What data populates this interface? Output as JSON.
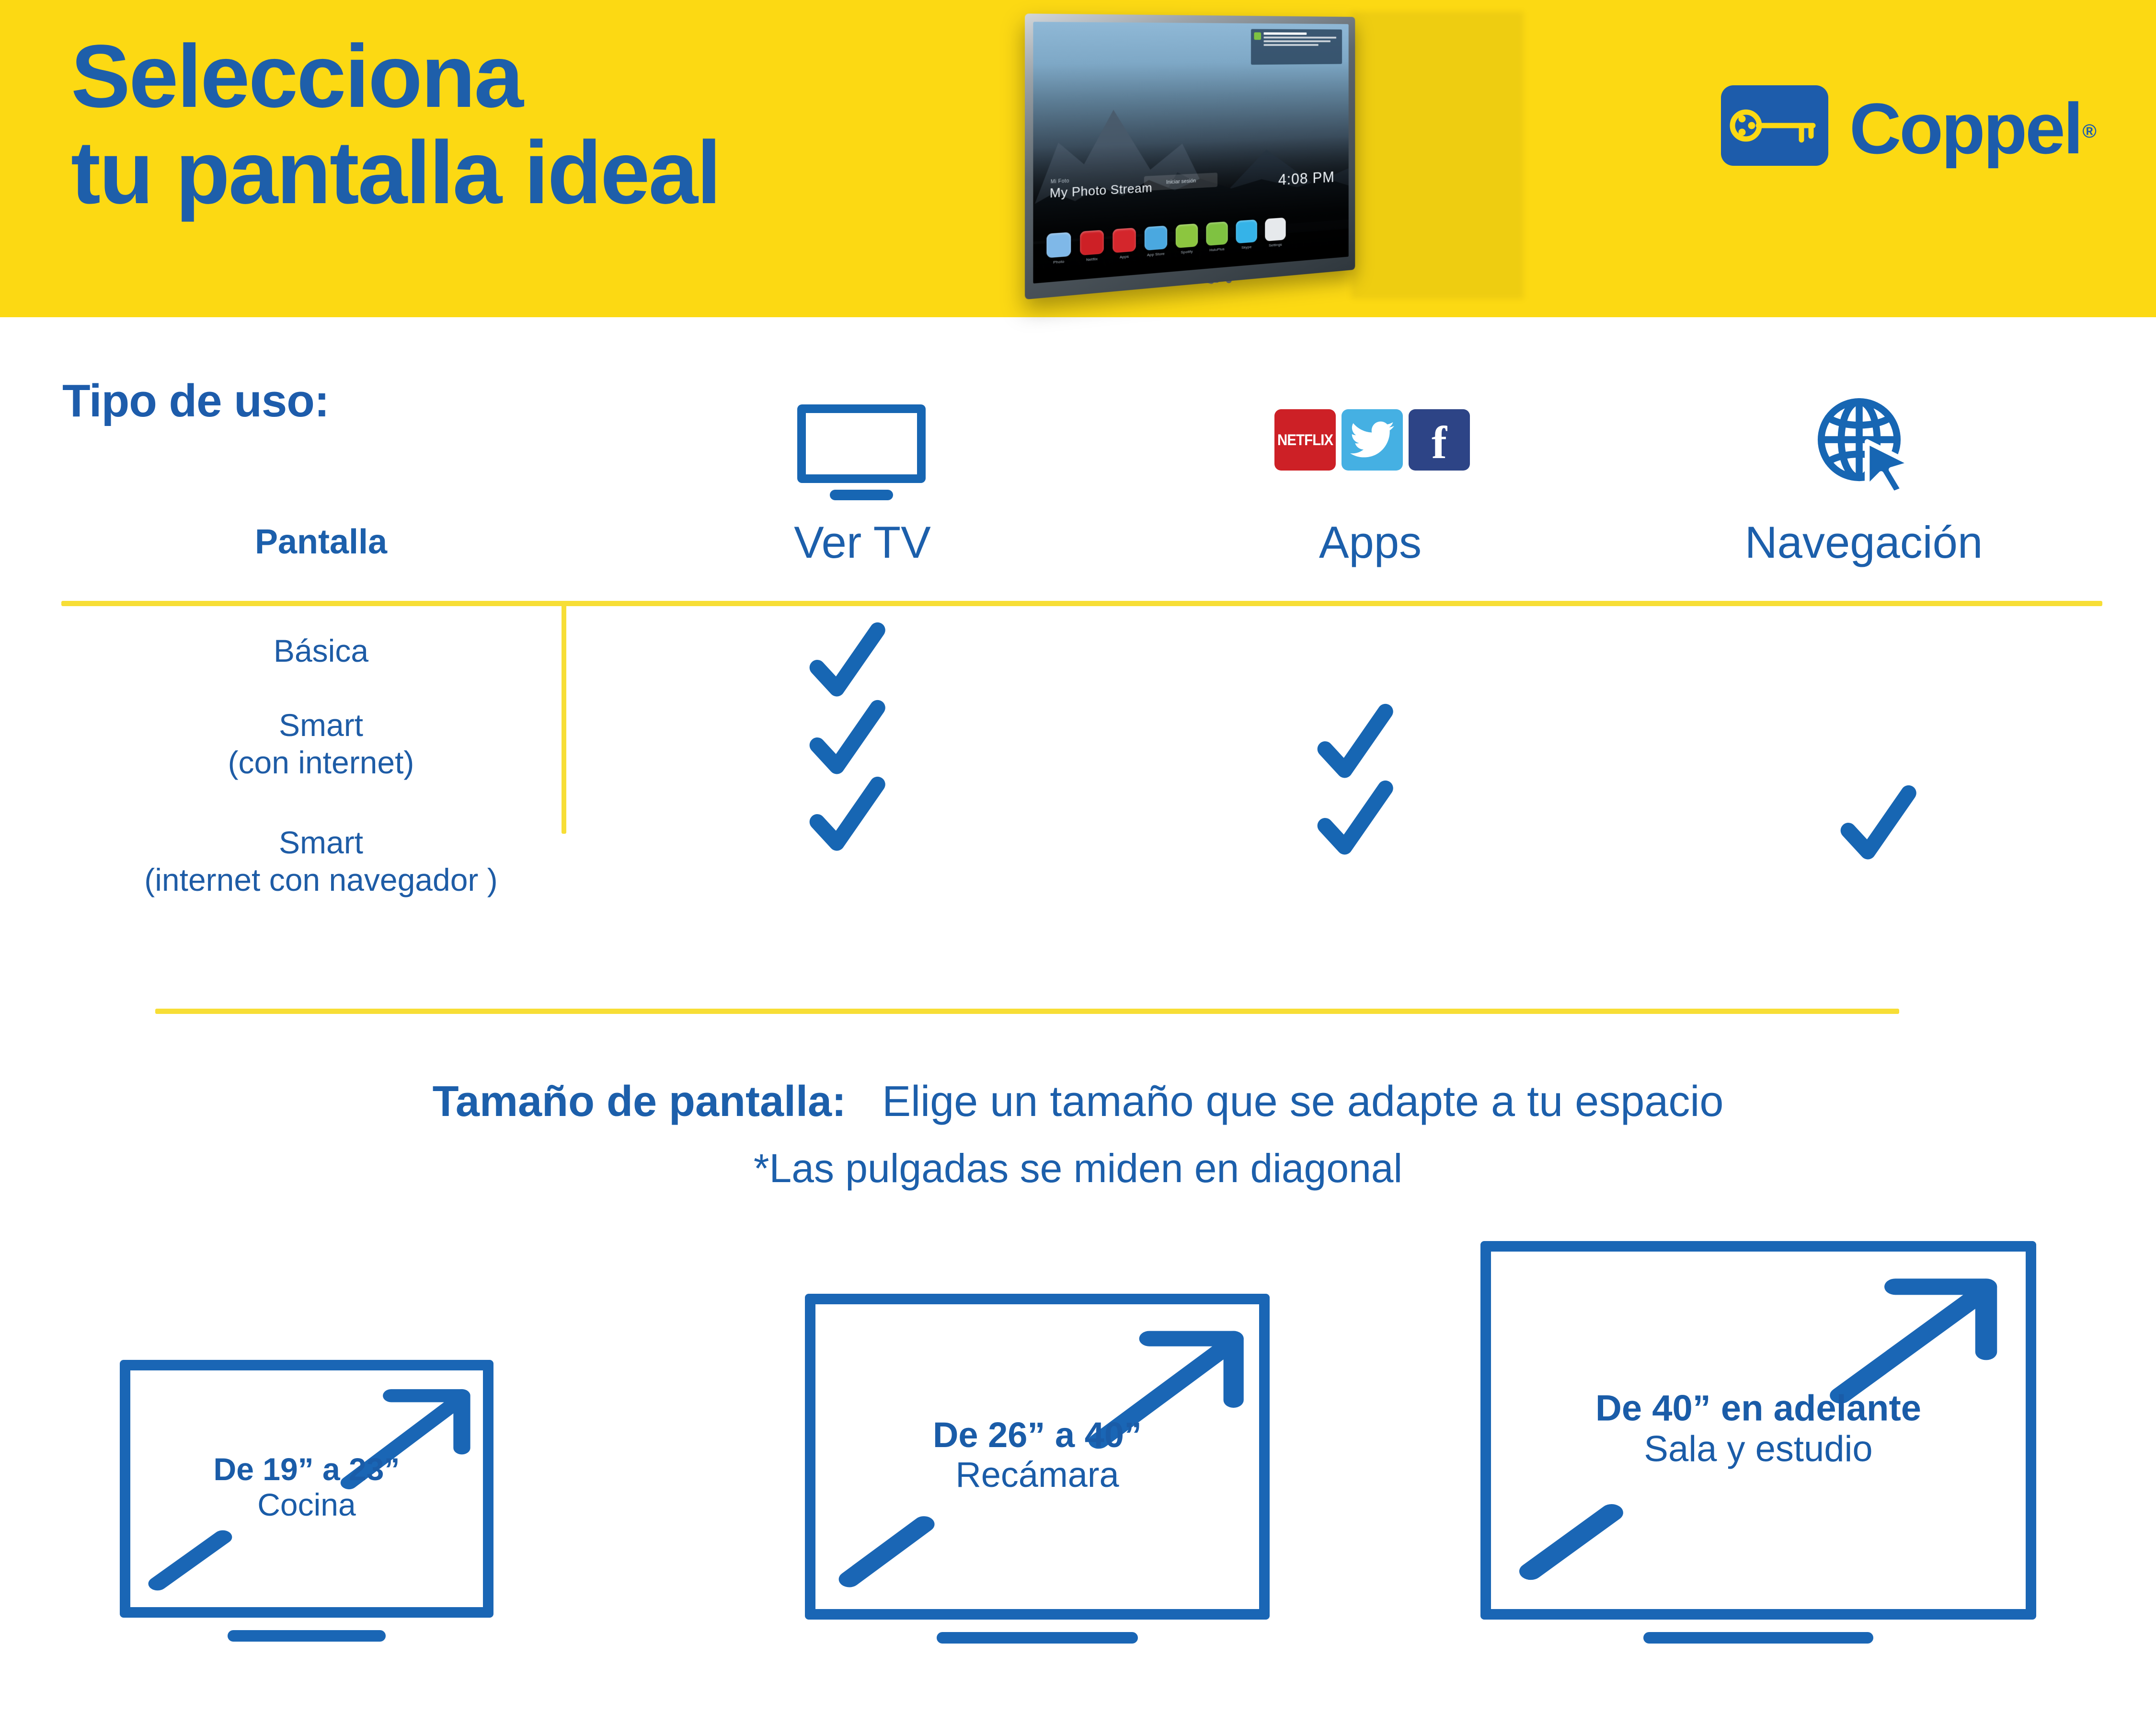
{
  "theme": {
    "yellow": "#FCD913",
    "rule_yellow": "#F7DE36",
    "blue": "#1C5FAB",
    "deep_blue": "#1A66B5"
  },
  "hero": {
    "title_line1": "Selecciona",
    "title_line2": "tu pantalla ideal"
  },
  "brand": {
    "name": "Coppel",
    "trademark": "®",
    "mark_icon": "key-icon"
  },
  "tv_photo": {
    "photo_stream_small": "Mi Foto",
    "photo_stream_label": "My Photo Stream",
    "clock": "4:08 PM",
    "center_pill": "Iniciar sesión",
    "notification_title": "Mega Recomienda",
    "apps": [
      {
        "name": "Photo",
        "color": "#7fb8e8"
      },
      {
        "name": "Netflix",
        "color": "#cd2026"
      },
      {
        "name": "Apps",
        "color": "#d4262c"
      },
      {
        "name": "App Store",
        "color": "#4aa8e0"
      },
      {
        "name": "Spotify",
        "color": "#8cc63f"
      },
      {
        "name": "HuluPlus",
        "color": "#7fc241"
      },
      {
        "name": "Skype",
        "color": "#35b3e8"
      },
      {
        "name": "Settings",
        "color": "#e6e9ec"
      }
    ]
  },
  "usage_section": {
    "heading": "Tipo de uso:",
    "row_header": "Pantalla",
    "columns": [
      {
        "label": "Ver TV",
        "icon": "monitor-icon"
      },
      {
        "label": "Apps",
        "icon": "social-apps-icon"
      },
      {
        "label": "Navegación",
        "icon": "globe-cursor-icon"
      }
    ],
    "app_icons": [
      {
        "name": "netflix-icon",
        "label": "NETFLIX",
        "color": "#CD2026"
      },
      {
        "name": "twitter-icon",
        "label": "",
        "color": "#45B0E3"
      },
      {
        "name": "facebook-icon",
        "label": "f",
        "color": "#2D4486"
      }
    ],
    "rows": [
      {
        "label_line1": "Básica",
        "label_line2": "",
        "checks": [
          true,
          false,
          false
        ]
      },
      {
        "label_line1": "Smart",
        "label_line2": "(con internet)",
        "checks": [
          true,
          true,
          false
        ]
      },
      {
        "label_line1": "Smart",
        "label_line2": "(internet con navegador )",
        "checks": [
          true,
          true,
          true
        ]
      }
    ]
  },
  "size_section": {
    "heading_bold": "Tamaño de pantalla:",
    "heading_rest": "Elige un tamaño que se adapte a tu espacio",
    "note": "*Las pulgadas se miden en diagonal",
    "boxes": [
      {
        "range": "De 19” a 23”",
        "room": "Cocina"
      },
      {
        "range": "De 26” a 40”",
        "room": "Recámara"
      },
      {
        "range": "De 40” en adelante",
        "room": "Sala y estudio"
      }
    ]
  }
}
